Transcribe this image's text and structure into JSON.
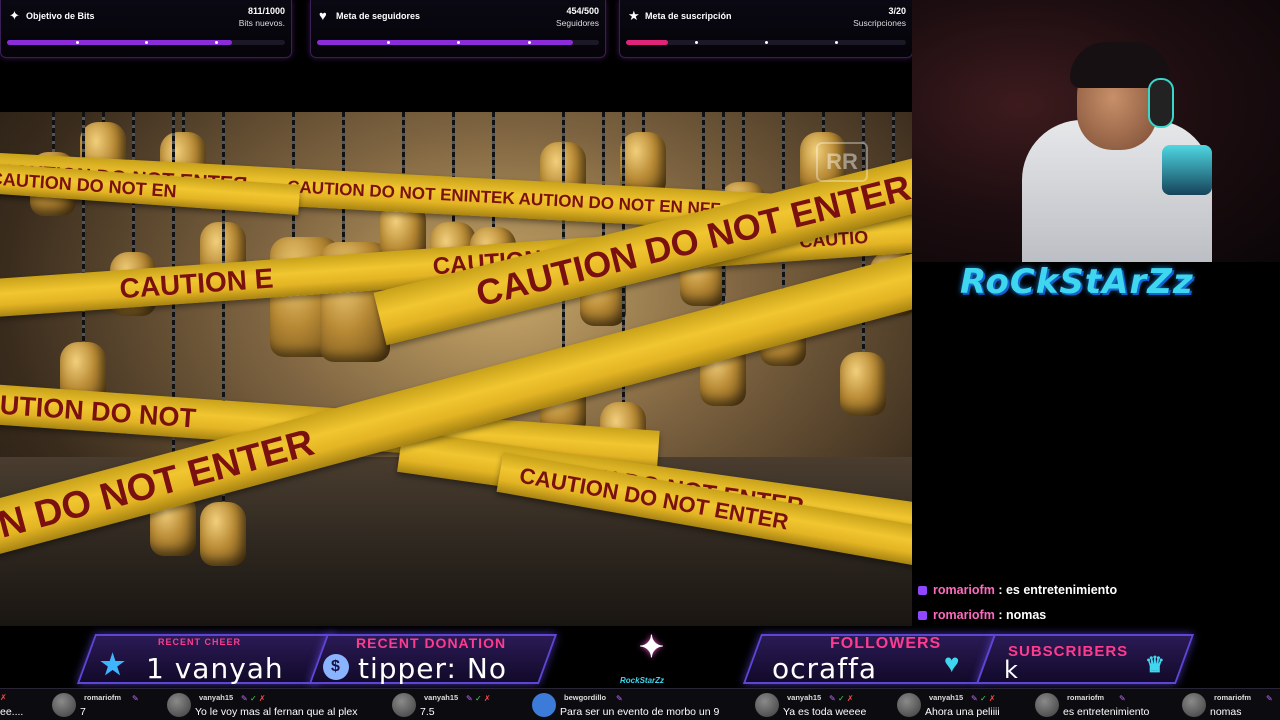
{
  "goals": [
    {
      "icon": "✦",
      "title": "Objetivo de Bits",
      "count": "811/1000",
      "sub": "Bits nuevos.",
      "progress": 0.811,
      "color": "#8b2bd9"
    },
    {
      "icon": "♥",
      "title": "Meta de seguidores",
      "count": "454/500",
      "sub": "Seguidores",
      "progress": 0.908,
      "color": "#8b2bd9"
    },
    {
      "icon": "★",
      "title": "Meta de suscripción",
      "count": "3/20",
      "sub": "Suscripciones",
      "progress": 0.15,
      "color": "#e0247a"
    }
  ],
  "video": {
    "tape_text_1": "CAUTION DO NOT ENTER",
    "tape_text_2": "CAUTION DO NOT ENTER",
    "tape_text_3": "CAUTION DO NOT ENTER",
    "tape_text_4": "N DO NOT ENTER",
    "tape_text_5": "CAUTION DO NOT ENTER",
    "tape_text_6": "CAUTION E",
    "tape_text_7": "UTION DO NOT",
    "tape_text_8": "CAUTION DO NOT ENTEЯ",
    "tape_text_9": "CAUTION DO NOT ENINTEK AUTION DO NOT EN NFF",
    "tape_text_10": "CAUTION DO NOT EN",
    "tape_text_11": "CAUTIO",
    "tape_text_12": "CA",
    "watermark": "RR"
  },
  "streamer_logo": "RoCkStArZz",
  "chat": [
    {
      "user": "romariofm",
      "message": ": es entretenimiento"
    },
    {
      "user": "romariofm",
      "message": ": nomas"
    }
  ],
  "alerts": {
    "recent_cheer_label": "RECENT CHEER",
    "recent_cheer_value": "1   vanyah",
    "recent_donation_label": "RECENT DONATION",
    "recent_donation_value": "tipper: No",
    "logo_text": "RockStarZz",
    "followers_label": "FOLLOWERS",
    "followers_value": "ocraffa",
    "subscribers_label": "SUBSCRIBERS",
    "subscribers_value": "k"
  },
  "ticker": [
    {
      "user": "",
      "text": "ee...."
    },
    {
      "user": "romariofm",
      "text": "7"
    },
    {
      "user": "vanyah15",
      "text": "Yo le voy mas al fernan que al plex"
    },
    {
      "user": "vanyah15",
      "text": "7.5"
    },
    {
      "user": "bewgordillo",
      "text": "Para ser un evento de morbo un 9"
    },
    {
      "user": "vanyah15",
      "text": "Ya es toda weeee"
    },
    {
      "user": "vanyah15",
      "text": "Ahora una peliiii"
    },
    {
      "user": "romariofm",
      "text": "es entretenimiento"
    },
    {
      "user": "romariofm",
      "text": "nomas"
    }
  ]
}
